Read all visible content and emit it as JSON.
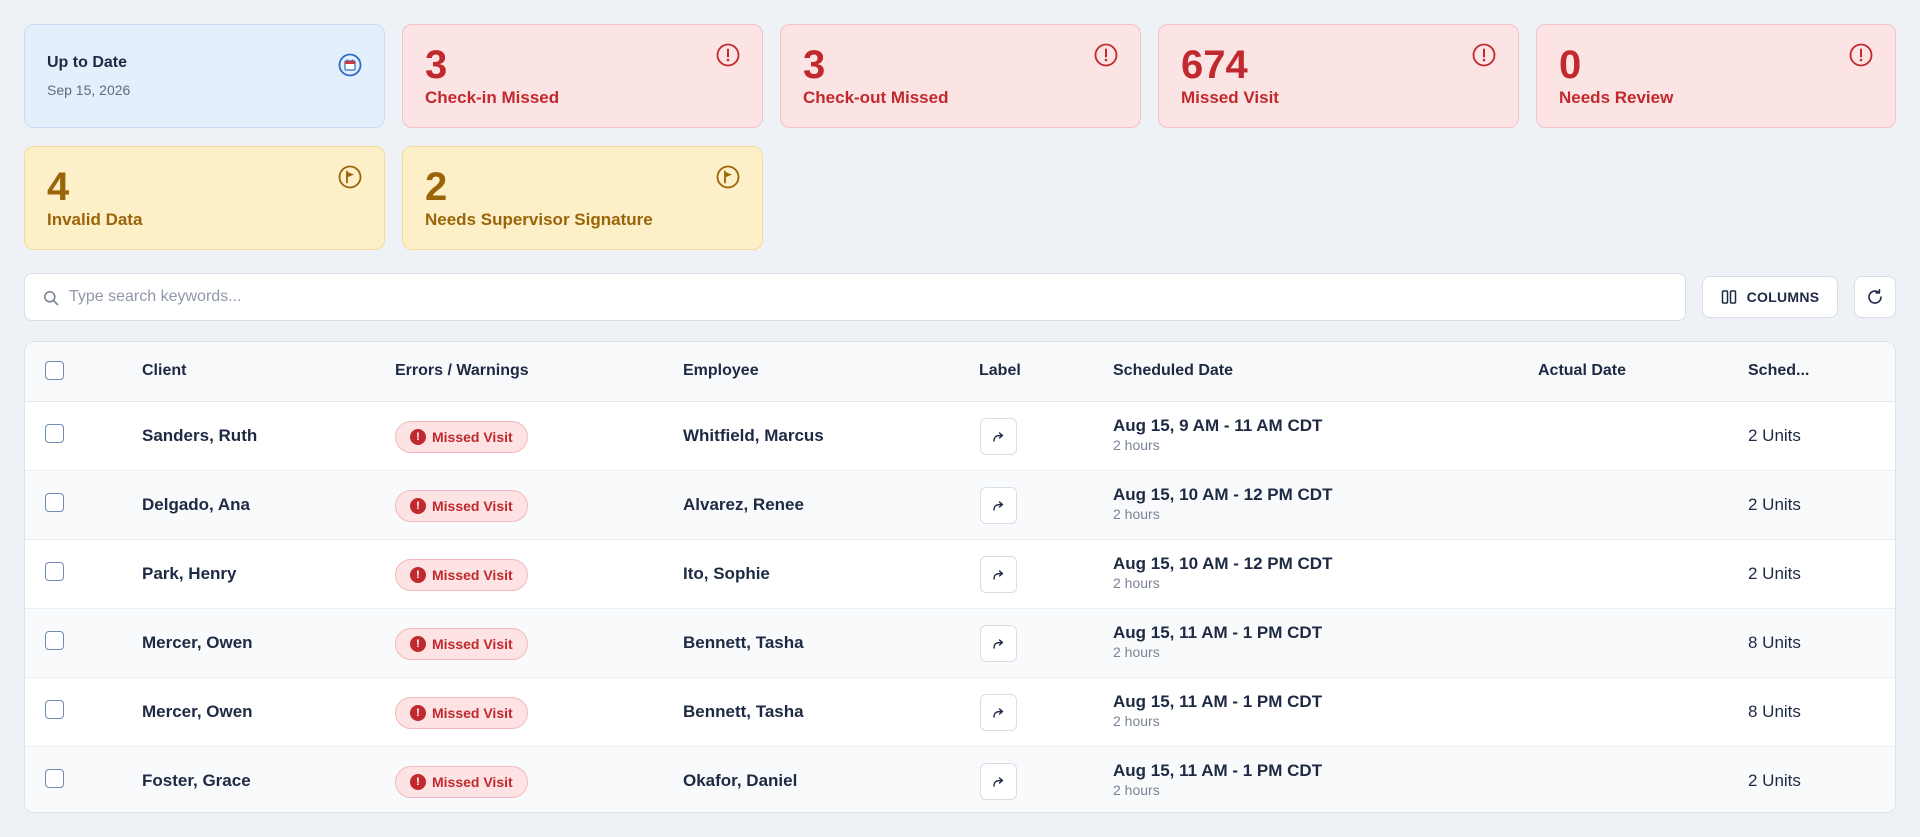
{
  "cards": {
    "up_to_date": {
      "title": "Up to Date",
      "date": "Sep 15, 2026",
      "icon": "calendar-icon"
    },
    "checkin_missed": {
      "value": "3",
      "label": "Check-in Missed",
      "icon": "alert-circle-icon"
    },
    "checkout_missed": {
      "value": "3",
      "label": "Check-out Missed",
      "icon": "alert-circle-icon"
    },
    "missed_visit": {
      "value": "674",
      "label": "Missed Visit",
      "icon": "alert-circle-icon"
    },
    "needs_review": {
      "value": "0",
      "label": "Needs Review",
      "icon": "alert-circle-icon"
    },
    "invalid_data": {
      "value": "4",
      "label": "Invalid Data",
      "icon": "flag-icon"
    },
    "needs_signature": {
      "value": "2",
      "label": "Needs Supervisor Signature",
      "icon": "flag-icon"
    }
  },
  "colors": {
    "error": "#c0292d",
    "warning": "#9a6508",
    "info_bg": "#e4effc",
    "error_bg": "#fce4e5",
    "warning_bg": "#fdf0c8"
  },
  "search": {
    "placeholder": "Type search keywords...",
    "value": ""
  },
  "toolbar": {
    "columns_label": "COLUMNS"
  },
  "table": {
    "headers": {
      "client": "Client",
      "errors": "Errors / Warnings",
      "employee": "Employee",
      "label": "Label",
      "scheduled_date": "Scheduled Date",
      "actual_date": "Actual Date",
      "sched_units": "Sched..."
    },
    "rows": [
      {
        "client": "Sanders, Ruth",
        "error": "Missed Visit",
        "employee": "Whitfield, Marcus",
        "scheduled": "Aug 15, 9 AM - 11 AM CDT",
        "duration": "2 hours",
        "actual": "",
        "units": "2 Units"
      },
      {
        "client": "Delgado, Ana",
        "error": "Missed Visit",
        "employee": "Alvarez, Renee",
        "scheduled": "Aug 15, 10 AM - 12 PM CDT",
        "duration": "2 hours",
        "actual": "",
        "units": "2 Units"
      },
      {
        "client": "Park, Henry",
        "error": "Missed Visit",
        "employee": "Ito, Sophie",
        "scheduled": "Aug 15, 10 AM - 12 PM CDT",
        "duration": "2 hours",
        "actual": "",
        "units": "2 Units"
      },
      {
        "client": "Mercer, Owen",
        "error": "Missed Visit",
        "employee": "Bennett, Tasha",
        "scheduled": "Aug 15, 11 AM - 1 PM CDT",
        "duration": "2 hours",
        "actual": "",
        "units": "8 Units"
      },
      {
        "client": "Mercer, Owen",
        "error": "Missed Visit",
        "employee": "Bennett, Tasha",
        "scheduled": "Aug 15, 11 AM - 1 PM CDT",
        "duration": "2 hours",
        "actual": "",
        "units": "8 Units"
      },
      {
        "client": "Foster, Grace",
        "error": "Missed Visit",
        "employee": "Okafor, Daniel",
        "scheduled": "Aug 15, 11 AM - 1 PM CDT",
        "duration": "2 hours",
        "actual": "",
        "units": "2 Units"
      }
    ]
  }
}
